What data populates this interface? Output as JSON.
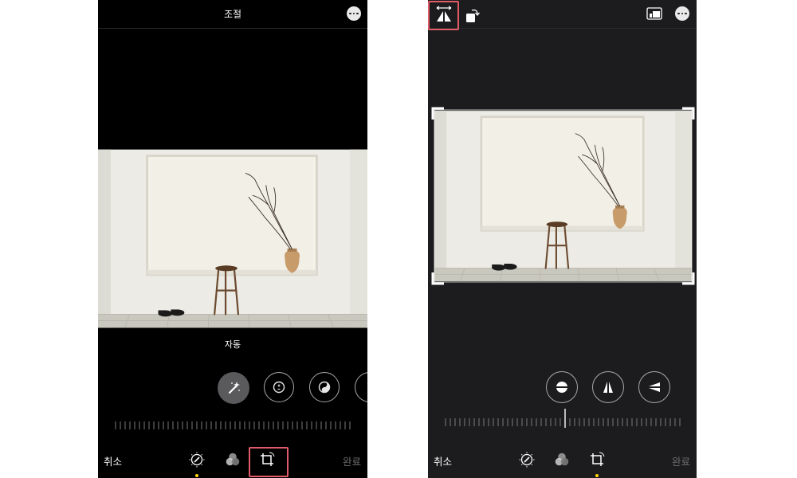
{
  "left": {
    "title": "조절",
    "auto_label": "자동",
    "cancel_label": "취소",
    "done_label": "완료",
    "tools": [
      "magic-wand-icon",
      "exposure-icon",
      "brilliance-icon"
    ]
  },
  "right": {
    "cancel_label": "취소",
    "done_label": "완료",
    "tools": [
      "straighten-icon",
      "vertical-perspective-icon",
      "horizontal-perspective-icon"
    ]
  },
  "colors": {
    "highlight": "#e05c66",
    "active_dot": "#ffd60a",
    "wall": "#efece5",
    "floor": "#c8c7bd"
  }
}
